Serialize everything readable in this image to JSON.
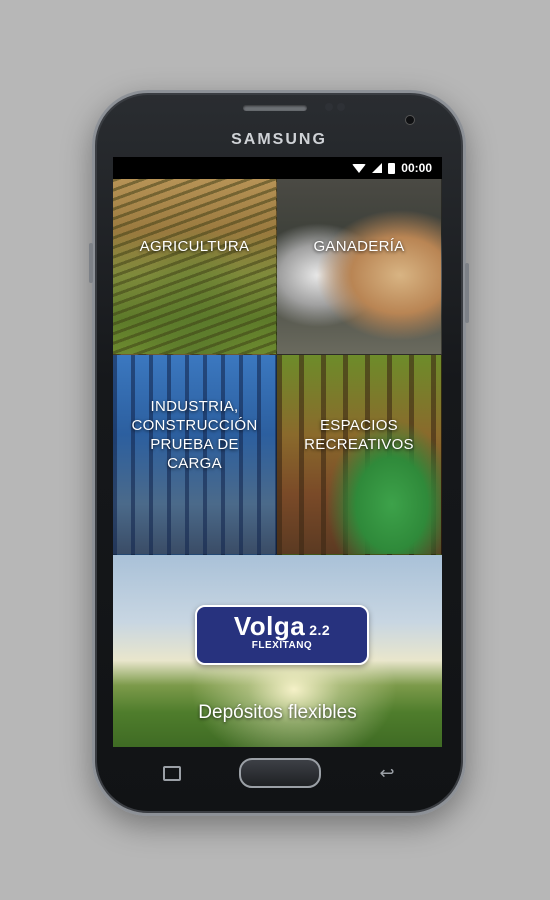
{
  "device": {
    "brand": "SAMSUNG"
  },
  "statusbar": {
    "time": "00:00",
    "icons": [
      "wifi-icon",
      "signal-icon",
      "battery-icon"
    ]
  },
  "tiles": [
    {
      "label": "AGRICULTURA"
    },
    {
      "label": "GANADERÍA"
    },
    {
      "label": "INDUSTRIA,\nCONSTRUCCIÓN\nPRUEBA DE CARGA"
    },
    {
      "label": "ESPACIOS\nRECREATIVOS"
    }
  ],
  "banner": {
    "logo_main": "Volga",
    "logo_version": "2.2",
    "logo_sub": "FLEXITANQ",
    "label": "Depósitos flexibles"
  },
  "navbar": {
    "icons": [
      "recents-icon",
      "home-button",
      "back-icon"
    ]
  }
}
